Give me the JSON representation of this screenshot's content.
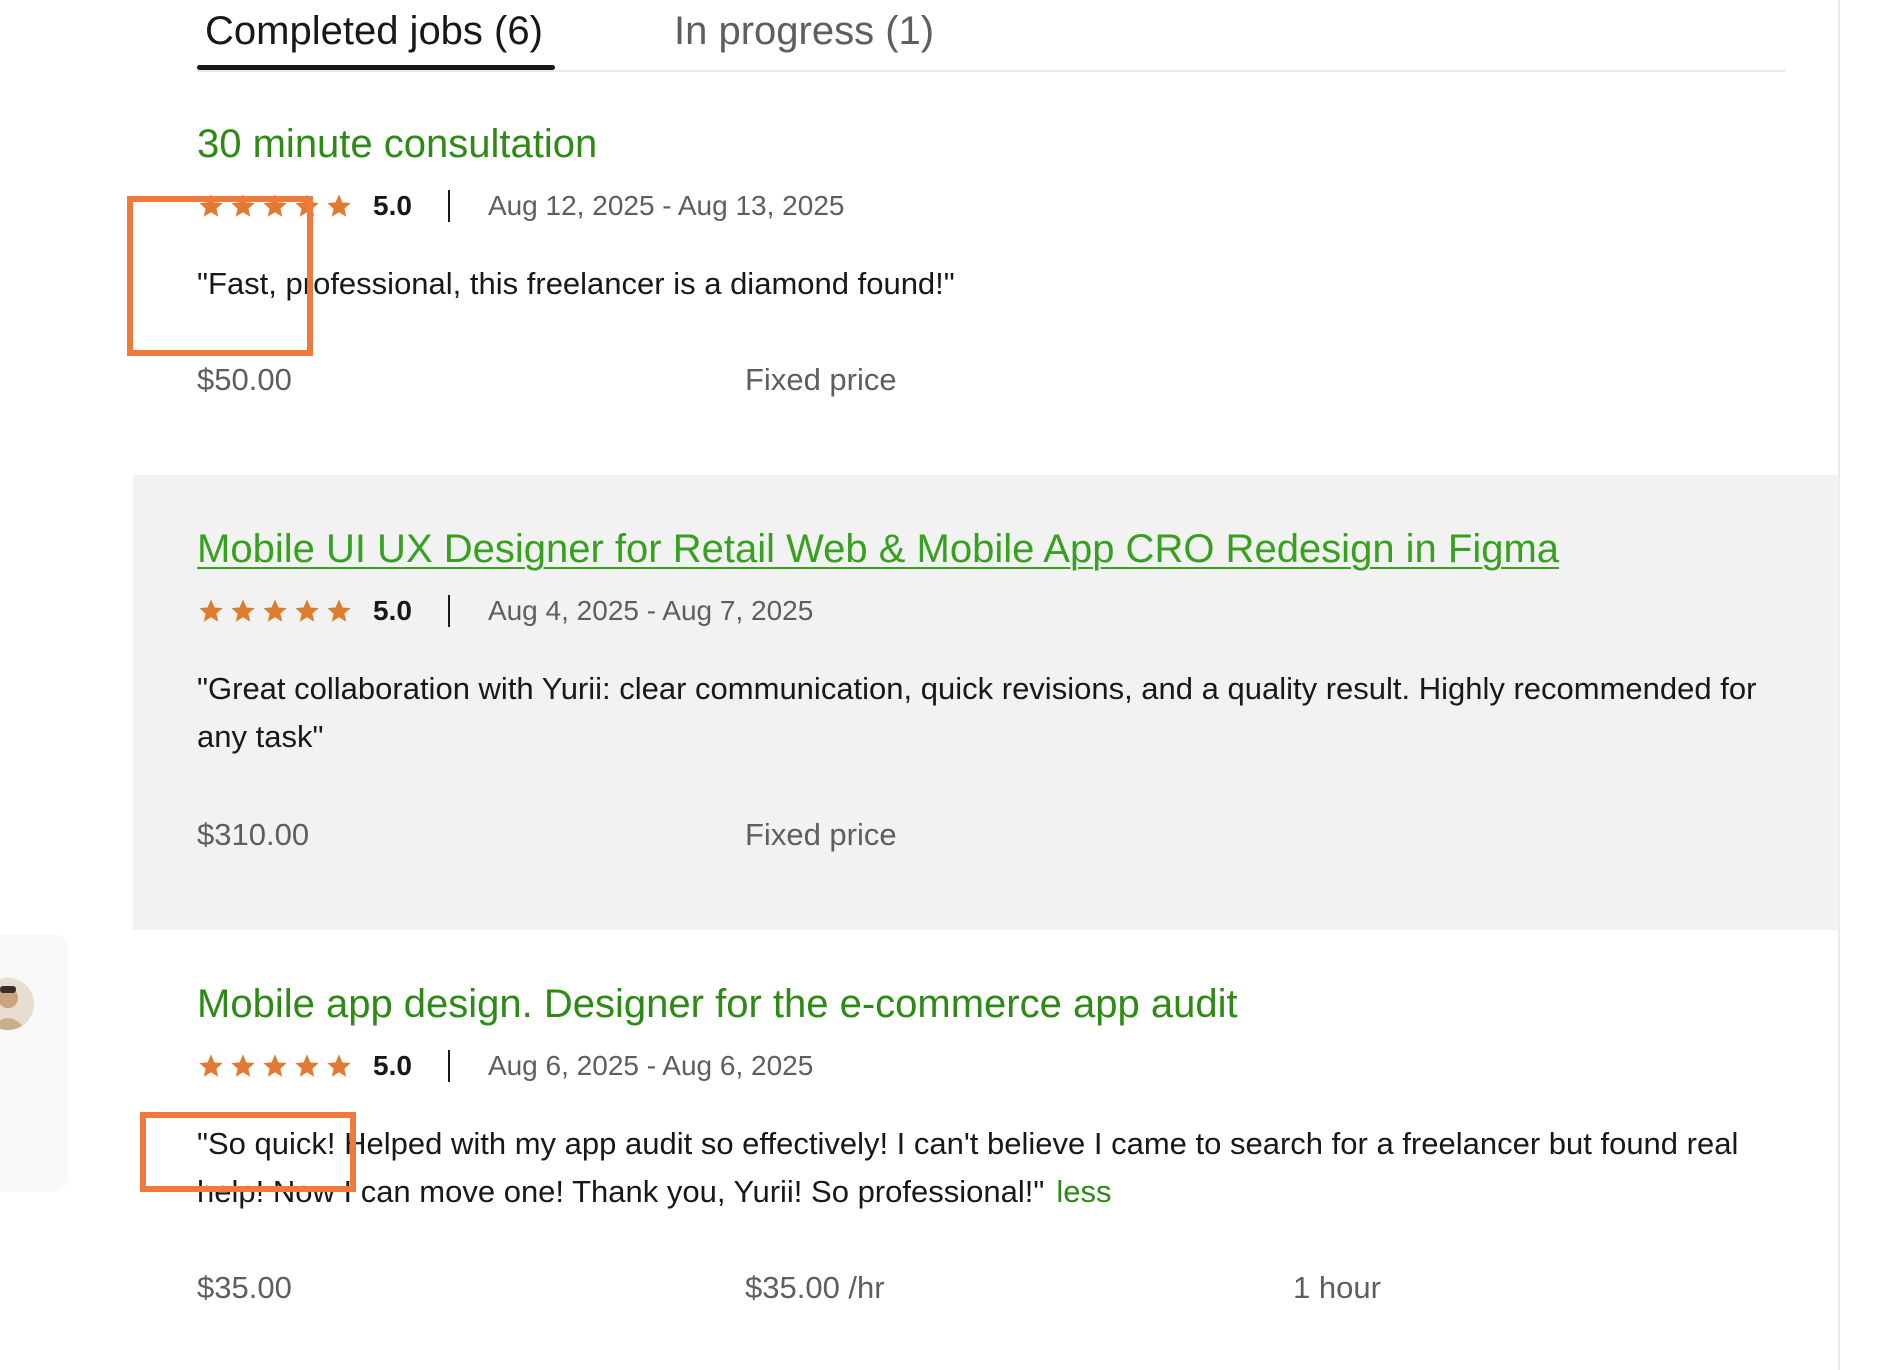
{
  "tabs": {
    "completed": "Completed jobs (6)",
    "in_progress": "In progress (1)"
  },
  "jobs": [
    {
      "title": "30 minute consultation",
      "rating": "5.0",
      "dates": "Aug 12, 2025 - Aug 13, 2025",
      "feedback": "\"Fast, professional, this freelancer is a diamond found!\"",
      "amount": "$50.00",
      "rate": "Fixed price",
      "duration": ""
    },
    {
      "title": "Mobile UI UX Designer for Retail Web & Mobile App CRO Redesign in Figma",
      "rating": "5.0",
      "dates": "Aug 4, 2025 - Aug 7, 2025",
      "feedback": "\"Great collaboration with Yurii: clear communication, quick revisions, and a quality result. Highly recommended for any task\"",
      "amount": "$310.00",
      "rate": "Fixed price",
      "duration": ""
    },
    {
      "title": "Mobile app design. Designer for the e-commerce app audit",
      "rating": "5.0",
      "dates": "Aug 6, 2025 - Aug 6, 2025",
      "feedback": "\"So quick! Helped with my app audit so effectively! I can't believe I came to search for a freelancer but found real help! Now I can move one! Thank you, Yurii! So professional!\"",
      "less_label": "less",
      "amount": "$35.00",
      "rate": "$35.00 /hr",
      "duration": "1 hour"
    }
  ],
  "colors": {
    "title_green": "#2d8a14",
    "star_orange": "#e07a2e",
    "annotation_orange": "#f07a3a",
    "highlight_bg": "#f2f2f2"
  },
  "icons": {
    "star": "star-icon",
    "avatar": "avatar"
  }
}
